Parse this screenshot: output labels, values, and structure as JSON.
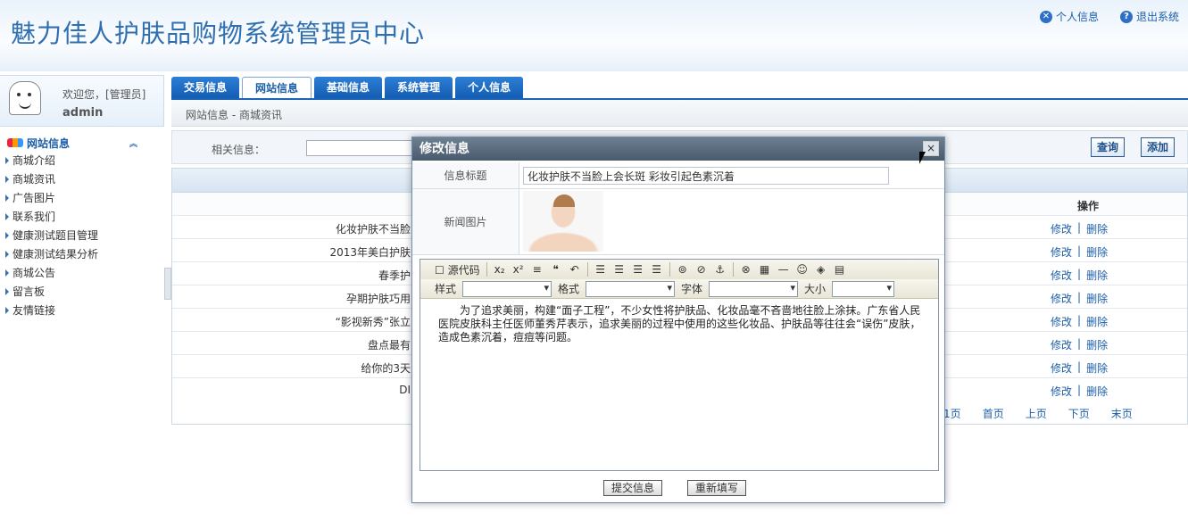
{
  "header": {
    "title": "魅力佳人护肤品购物系统管理员中心",
    "links": [
      {
        "label": "个人信息",
        "icon": "user-info-icon"
      },
      {
        "label": "退出系统",
        "icon": "help-icon"
      }
    ]
  },
  "user": {
    "welcome": "欢迎您，[管理员]",
    "name": "admin"
  },
  "sidebar": {
    "section": "网站信息",
    "items": [
      "商城介绍",
      "商城资讯",
      "广告图片",
      "联系我们",
      "健康测试题目管理",
      "健康测试结果分析",
      "商城公告",
      "留言板",
      "友情链接"
    ]
  },
  "tabs": [
    "交易信息",
    "网站信息",
    "基础信息",
    "系统管理",
    "个人信息"
  ],
  "active_tab": 1,
  "breadcrumb": "网站信息 - 商城资讯",
  "filter": {
    "label": "相关信息：",
    "query_button": "查询",
    "add_button": "添加"
  },
  "table": {
    "ops_header": "操作",
    "rows": [
      {
        "title": "化妆护肤不当脸"
      },
      {
        "title": "2013年美白护肤"
      },
      {
        "title": "春季护"
      },
      {
        "title": "孕期护肤巧用"
      },
      {
        "title": "“影视新秀”张立"
      },
      {
        "title": "盘点最有"
      },
      {
        "title": "给你的3天"
      },
      {
        "title": "DI"
      }
    ],
    "edit_label": "修改",
    "sep": "|",
    "delete_label": "删除",
    "pager": [
      "/1页",
      "首页",
      "上页",
      "下页",
      "末页"
    ]
  },
  "modal": {
    "title": "修改信息",
    "close": "×",
    "title_label": "信息标题",
    "title_value": "化妆护肤不当脸上会长斑 彩妆引起色素沉着",
    "image_label": "新闻图片",
    "toolbar": {
      "source": "源代码",
      "style_label": "样式",
      "format_label": "格式",
      "font_label": "字体",
      "size_label": "大小"
    },
    "content": "为了追求美丽，构建“面子工程”，不少女性将护肤品、化妆品毫不吝啬地往脸上涂抹。广东省人民医院皮肤科主任医师董秀芹表示，追求美丽的过程中使用的这些化妆品、护肤品等往往会“误伤”皮肤，造成色素沉着，痘痘等问题。",
    "submit": "提交信息",
    "reset": "重新填写"
  }
}
